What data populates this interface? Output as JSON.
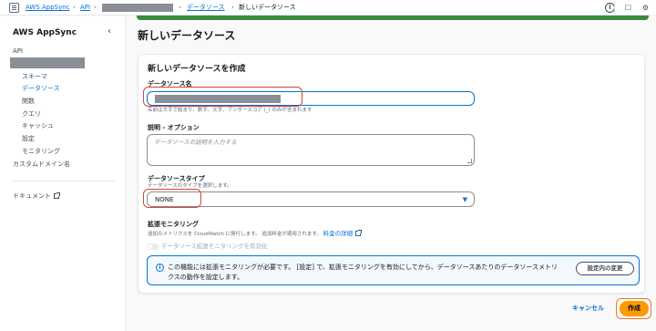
{
  "breadcrumb": {
    "root": "AWS AppSync",
    "api": "API",
    "data_sources": "データソース",
    "current": "新しいデータソース"
  },
  "sidebar": {
    "title": "AWS AppSync",
    "section": "API",
    "items": [
      "スキーマ",
      "データソース",
      "関数",
      "クエリ",
      "キャッシュ",
      "設定",
      "モニタリング"
    ],
    "custom_domain": "カスタムドメイン名",
    "docs": "ドキュメント"
  },
  "page": {
    "title": "新しいデータソース"
  },
  "form": {
    "card_title": "新しいデータソースを作成",
    "name_label": "データソース名",
    "name_help": "名前は文字で始まり、数字、文字、アンダースコア (_) のみが含まれます",
    "desc_label": "説明 - オプション",
    "desc_placeholder": "データソースの説明を入力する",
    "type_label": "データソースタイプ",
    "type_help": "データソースのタイプを選択します。",
    "type_value": "NONE",
    "monitor_label": "拡張モニタリング",
    "monitor_help": "追加のメトリクスを CloudWatch に発行します。 追加料金が適用されます。",
    "pricing_link": "料金の詳細",
    "toggle_label": "データソース拡張モニタリングを有効化",
    "info_text": "この機能には拡張モニタリングが必要です。 [設定] で、拡張モニタリングを有効にしてから、データソースあたりのデータソースメトリクスの動作を設定します。",
    "info_button": "設定内の変更"
  },
  "footer": {
    "cancel": "キャンセル",
    "create": "作成"
  },
  "colors": {
    "accent": "#0972d3",
    "primary_button": "#ff9900",
    "banner": "#3b8a3b",
    "highlight": "#d6452f"
  }
}
